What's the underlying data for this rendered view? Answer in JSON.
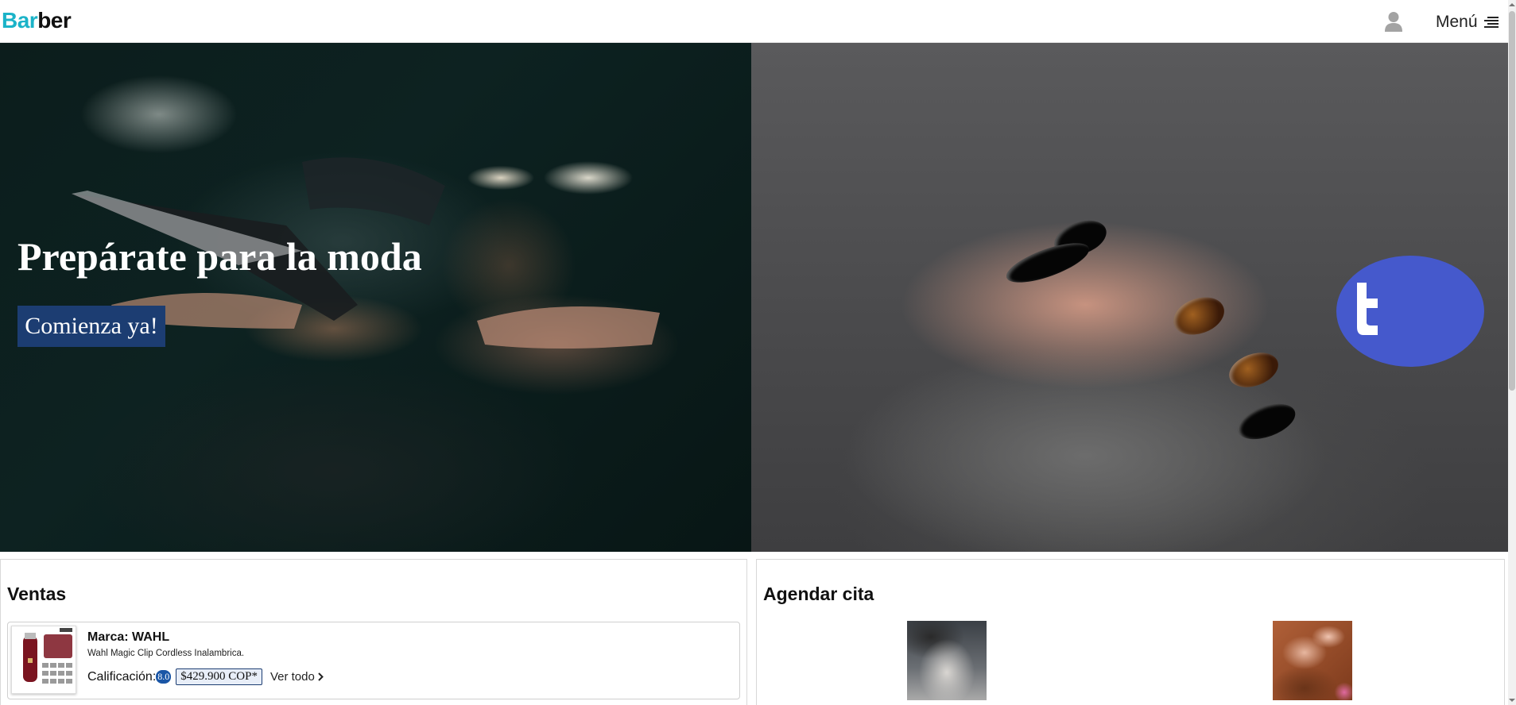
{
  "header": {
    "logo_part1": "Bar",
    "logo_part2": "ber",
    "user_icon": "user-icon",
    "menu_label": "Menú",
    "menu_icon": "menu-lines-icon"
  },
  "hero": {
    "title": "Prepárate para la moda",
    "cta_label": "Comienza ya!",
    "chat_icon": "chat-icon"
  },
  "ventas": {
    "title": "Ventas",
    "product": {
      "brand": "Marca: WAHL",
      "name": "Wahl Magic Clip Cordless Inalambrica.",
      "rating_label": "Calificación:",
      "rating_value": "8.0",
      "price": "$429.900 COP*",
      "see_all": "Ver todo"
    }
  },
  "cita": {
    "title": "Agendar cita"
  },
  "colors": {
    "accent": "#1bb3c8",
    "primary": "#1c3d72",
    "chat": "#4559cc",
    "badge": "#1a56a6"
  }
}
